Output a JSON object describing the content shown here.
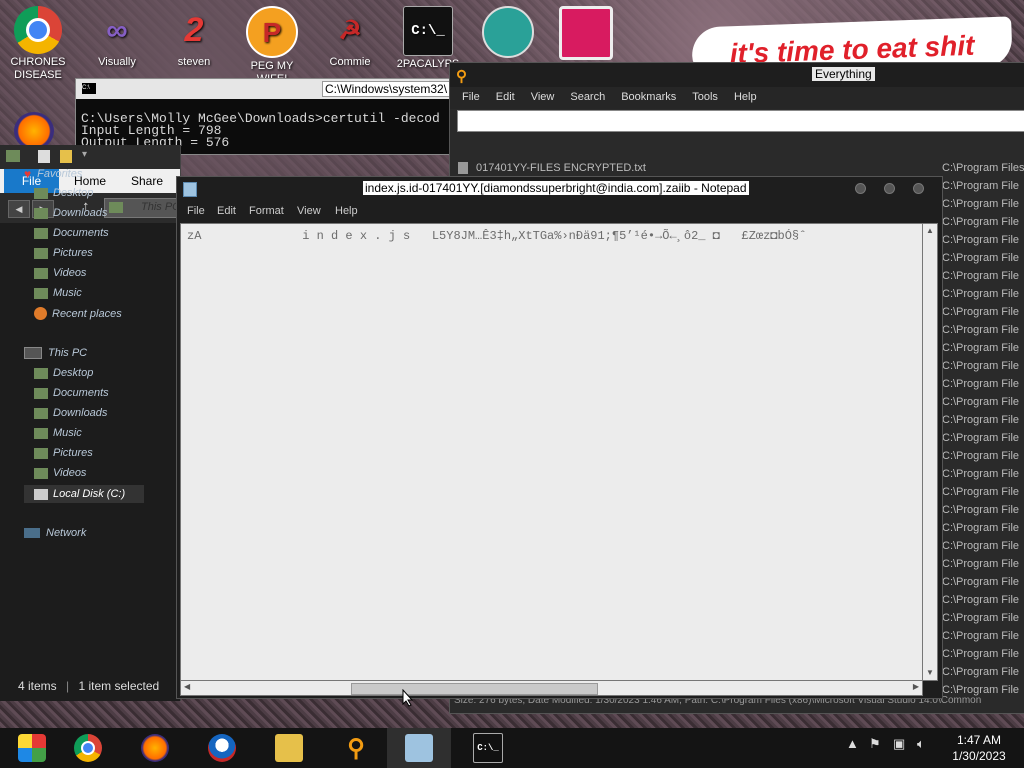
{
  "desktop": {
    "banner_text": "it's time to eat shit",
    "icons": [
      {
        "label": "CHRONES DISEASE",
        "icon": "chrome-icon",
        "color": "#e8453c"
      },
      {
        "label": "Visually",
        "icon": "visual-studio-icon",
        "color": "#865fc5"
      },
      {
        "label": "steven",
        "icon": "steven-icon",
        "color": "#1e6fcf"
      },
      {
        "label": "PEG MY WIFE!",
        "icon": "peg-icon",
        "color": "#f4a020"
      },
      {
        "label": "Commie",
        "icon": "commie-icon",
        "color": "#c62828"
      },
      {
        "label": "2PACALYPS",
        "icon": "cmd-icon",
        "color": "#111111"
      },
      {
        "label": "",
        "icon": "santa-icon",
        "color": "#2aa198"
      },
      {
        "label": "",
        "icon": "monitor-icon",
        "color": "#d81b60"
      }
    ]
  },
  "cmd": {
    "title": "C:\\Windows\\system32\\",
    "lines": "C:\\Users\\Molly McGee\\Downloads>certutil -decod\nInput Length = 798\nOutput Length = 576"
  },
  "everything": {
    "title": "Everything",
    "menu": [
      "File",
      "Edit",
      "View",
      "Search",
      "Bookmarks",
      "Tools",
      "Help"
    ],
    "search_value": "",
    "rows": [
      {
        "name": "017401YY-FILES ENCRYPTED.txt",
        "path": "C:\\Program Files"
      },
      {
        "name": "",
        "path": "C:\\Program File"
      },
      {
        "name": "",
        "path": "C:\\Program File"
      },
      {
        "name": "",
        "path": "C:\\Program File"
      },
      {
        "name": "",
        "path": "C:\\Program File"
      },
      {
        "name": "",
        "path": "C:\\Program File"
      },
      {
        "name": "",
        "path": "C:\\Program File"
      },
      {
        "name": "",
        "path": "C:\\Program File"
      },
      {
        "name": "",
        "path": "C:\\Program File"
      },
      {
        "name": "",
        "path": "C:\\Program File"
      },
      {
        "name": "",
        "path": "C:\\Program File"
      },
      {
        "name": "",
        "path": "C:\\Program File"
      },
      {
        "name": "",
        "path": "C:\\Program File"
      },
      {
        "name": "",
        "path": "C:\\Program File"
      },
      {
        "name": "",
        "path": "C:\\Program File"
      },
      {
        "name": "",
        "path": "C:\\Program File"
      },
      {
        "name": "",
        "path": "C:\\Program File"
      },
      {
        "name": "",
        "path": "C:\\Program File"
      },
      {
        "name": "",
        "path": "C:\\Program File"
      },
      {
        "name": "",
        "path": "C:\\Program File"
      },
      {
        "name": "",
        "path": "C:\\Program File"
      },
      {
        "name": "",
        "path": "C:\\Program File"
      },
      {
        "name": "",
        "path": "C:\\Program File"
      },
      {
        "name": "",
        "path": "C:\\Program File"
      },
      {
        "name": "",
        "path": "C:\\Program File"
      },
      {
        "name": "",
        "path": "C:\\Program File"
      },
      {
        "name": "",
        "path": "C:\\Program File"
      },
      {
        "name": "",
        "path": "C:\\Program File"
      },
      {
        "name": "",
        "path": "C:\\Program File"
      },
      {
        "name": "",
        "path": "C:\\Program File"
      }
    ],
    "status": "Size: 276 bytes, Date Modified: 1/30/2023 1:46 AM, Path: C:\\Program Files (x86)\\Microsoft Visual Studio 14.0\\Common"
  },
  "explorer": {
    "ribbon": {
      "file": "File",
      "home": "Home",
      "share": "Share"
    },
    "address": "This PC",
    "favorites_label": "Favorites",
    "favorites": [
      "Desktop",
      "Downloads",
      "Documents",
      "Pictures",
      "Videos",
      "Music",
      "Recent places"
    ],
    "thispc_label": "This PC",
    "thispc": [
      "Desktop",
      "Documents",
      "Downloads",
      "Music",
      "Pictures",
      "Videos",
      "Local Disk (C:)"
    ],
    "network_label": "Network",
    "status_items": "4 items",
    "status_selected": "1 item selected"
  },
  "notepad": {
    "title": "index.js.id-017401YY.[diamondssuperbright@india.com].zaiib - Notepad",
    "menu": [
      "File",
      "Edit",
      "Format",
      "View",
      "Help"
    ],
    "content": "zA              i n d e x . j s   L5Y8JM…Ê3‡h„XtTGa%›nÐä91;¶5’¹é•→Õ←¸ô2_ ◘   £Zœz◘bÓ§ˆ"
  },
  "taskbar": {
    "apps": [
      "windows-media-icon",
      "chrome-icon",
      "firefox-icon",
      "obama-icon",
      "file-explorer-icon",
      "everything-icon",
      "notepad-icon",
      "cmd-icon"
    ],
    "time": "1:47 AM",
    "date": "1/30/2023"
  }
}
